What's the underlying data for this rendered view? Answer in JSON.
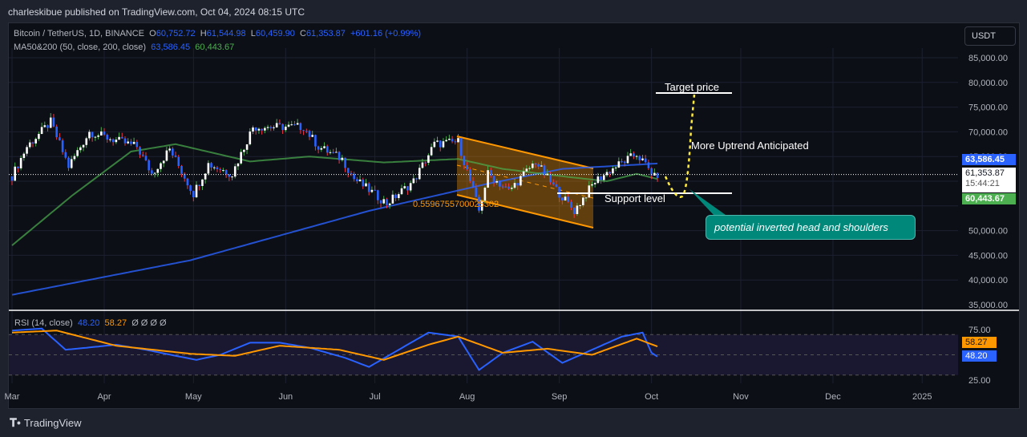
{
  "header": {
    "published": "charleskibue published on TradingView.com, Oct 04, 2024 08:15 UTC"
  },
  "legend": {
    "symbol": "Bitcoin / TetherUS, 1D, BINANCE",
    "o_label": "O",
    "o": "60,752.72",
    "h_label": "H",
    "h": "61,544.98",
    "l_label": "L",
    "l": "60,459.90",
    "c_label": "C",
    "c": "61,353.87",
    "change": "+601.16 (+0.99%)",
    "ma_label": "MA50&200 (50, close, 200, close)",
    "ma50": "63,586.45",
    "ma200": "60,443.67",
    "rsi_label": "RSI (14, close)",
    "rsi": "48.20",
    "rsi_ma": "58.27",
    "rsi_extra": "Ø Ø Ø Ø"
  },
  "currency": "USDT",
  "price_labels": {
    "ma_blue": "63,586.45",
    "last": "61,353.87",
    "countdown": "15:44:21",
    "ma_green": "60,443.67",
    "rsi_ma": "58.27",
    "rsi": "48.20"
  },
  "annotations": {
    "target": "Target price",
    "uptrend": "More Uptrend Anticipated",
    "support": "Support level",
    "fib": "0.5596755700025302",
    "callout": "potential inverted head and shoulders"
  },
  "colors": {
    "up": "#ffffff",
    "down": "#2962ff",
    "ma_short": "#2962ff",
    "ma_long": "#4caf50",
    "rsi": "#2962ff",
    "rsi_ma": "#ff9800",
    "channel": "#ff9800",
    "dotted": "#ffeb3b",
    "callout": "#00897b"
  },
  "footer": {
    "brand": "TradingView"
  },
  "chart_data": {
    "type": "candlestick",
    "title": "Bitcoin / TetherUS, 1D, BINANCE",
    "ylim": [
      35000,
      85000
    ],
    "y_ticks": [
      "85,000.00",
      "80,000.00",
      "75,000.00",
      "70,000.00",
      "65,000.00",
      "50,000.00",
      "45,000.00",
      "40,000.00",
      "35,000.00"
    ],
    "x_ticks": [
      "Mar",
      "Apr",
      "May",
      "Jun",
      "Jul",
      "Aug",
      "Sep",
      "Oct",
      "Nov",
      "Dec",
      "2025"
    ],
    "close_keypoints_day_from_mar1": [
      [
        0,
        61000
      ],
      [
        5,
        67000
      ],
      [
        13,
        72000
      ],
      [
        19,
        63000
      ],
      [
        26,
        70000
      ],
      [
        31,
        69000
      ],
      [
        42,
        67000
      ],
      [
        47,
        61500
      ],
      [
        53,
        66500
      ],
      [
        61,
        57500
      ],
      [
        66,
        63500
      ],
      [
        74,
        61500
      ],
      [
        81,
        71000
      ],
      [
        98,
        71000
      ],
      [
        103,
        67000
      ],
      [
        111,
        64500
      ],
      [
        115,
        60500
      ],
      [
        126,
        55500
      ],
      [
        135,
        60000
      ],
      [
        142,
        67500
      ],
      [
        150,
        68000
      ],
      [
        157,
        54000
      ],
      [
        160,
        61500
      ],
      [
        167,
        58000
      ],
      [
        176,
        64000
      ],
      [
        182,
        59000
      ],
      [
        189,
        54000
      ],
      [
        196,
        60000
      ],
      [
        203,
        63000
      ],
      [
        210,
        65500
      ],
      [
        213,
        63300
      ],
      [
        216,
        60800
      ],
      [
        217,
        61354
      ]
    ],
    "ma_short_keypoints": [
      [
        0,
        37000
      ],
      [
        60,
        44000
      ],
      [
        120,
        54000
      ],
      [
        160,
        59500
      ],
      [
        185,
        62500
      ],
      [
        217,
        63586
      ]
    ],
    "ma_long_keypoints": [
      [
        0,
        47000
      ],
      [
        20,
        57000
      ],
      [
        40,
        66000
      ],
      [
        55,
        67500
      ],
      [
        80,
        64000
      ],
      [
        100,
        65000
      ],
      [
        125,
        63800
      ],
      [
        150,
        64500
      ],
      [
        165,
        62500
      ],
      [
        185,
        61000
      ],
      [
        200,
        60000
      ],
      [
        210,
        61500
      ],
      [
        217,
        60444
      ]
    ],
    "rsi_keypoints": [
      [
        0,
        74
      ],
      [
        10,
        76
      ],
      [
        18,
        55
      ],
      [
        25,
        57
      ],
      [
        35,
        60
      ],
      [
        45,
        55
      ],
      [
        55,
        49
      ],
      [
        62,
        45
      ],
      [
        70,
        50
      ],
      [
        80,
        62
      ],
      [
        90,
        62
      ],
      [
        100,
        57
      ],
      [
        112,
        47
      ],
      [
        120,
        38
      ],
      [
        130,
        55
      ],
      [
        140,
        72
      ],
      [
        150,
        68
      ],
      [
        157,
        35
      ],
      [
        165,
        52
      ],
      [
        175,
        63
      ],
      [
        185,
        42
      ],
      [
        195,
        55
      ],
      [
        205,
        68
      ],
      [
        212,
        72
      ],
      [
        215,
        52
      ],
      [
        217,
        48.2
      ]
    ],
    "rsi_ma_keypoints": [
      [
        0,
        72
      ],
      [
        15,
        74
      ],
      [
        35,
        59
      ],
      [
        60,
        51
      ],
      [
        75,
        49
      ],
      [
        90,
        59
      ],
      [
        110,
        55
      ],
      [
        125,
        45
      ],
      [
        140,
        60
      ],
      [
        150,
        68
      ],
      [
        165,
        52
      ],
      [
        180,
        56
      ],
      [
        195,
        50
      ],
      [
        210,
        66
      ],
      [
        217,
        58.27
      ]
    ],
    "rsi_ylim": [
      0,
      100
    ],
    "rsi_levels": [
      70,
      50,
      30
    ]
  }
}
